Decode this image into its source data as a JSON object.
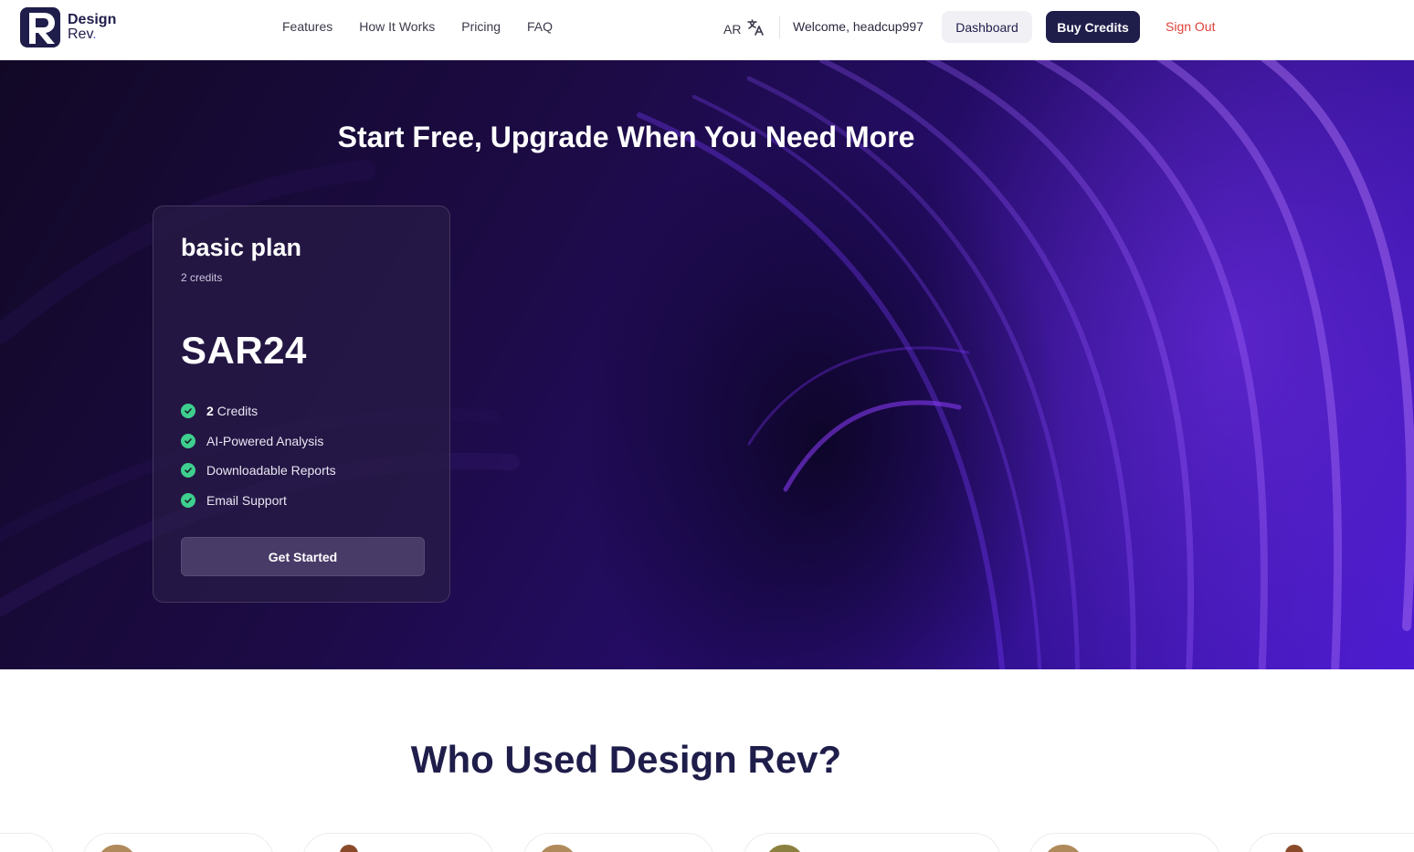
{
  "header": {
    "logo": {
      "line1": "Design",
      "line2": "Rev",
      "dot": "."
    },
    "nav": [
      "Features",
      "How It Works",
      "Pricing",
      "FAQ"
    ],
    "lang": "AR",
    "welcome": "Welcome, headcup997",
    "dashboard": "Dashboard",
    "buy_credits": "Buy Credits",
    "sign_out": "Sign Out"
  },
  "hero": {
    "title": "Start Free, Upgrade When You Need More",
    "plan": {
      "name": "basic plan",
      "credits_label": "2 credits",
      "price": "SAR24",
      "features": [
        {
          "bold": "2",
          "text": "Credits"
        },
        {
          "bold": "",
          "text": "AI-Powered Analysis"
        },
        {
          "bold": "",
          "text": "Downloadable Reports"
        },
        {
          "bold": "",
          "text": "Email Support"
        }
      ],
      "cta": "Get Started"
    }
  },
  "who": {
    "title": "Who Used Design Rev?"
  },
  "colors": {
    "brand": "#1f1d4a",
    "accent_purple": "#4b1ad0",
    "check_green": "#3ecf8e",
    "sign_out_red": "#e0403a"
  },
  "icons": [
    "translate-icon",
    "check-circle-icon"
  ]
}
